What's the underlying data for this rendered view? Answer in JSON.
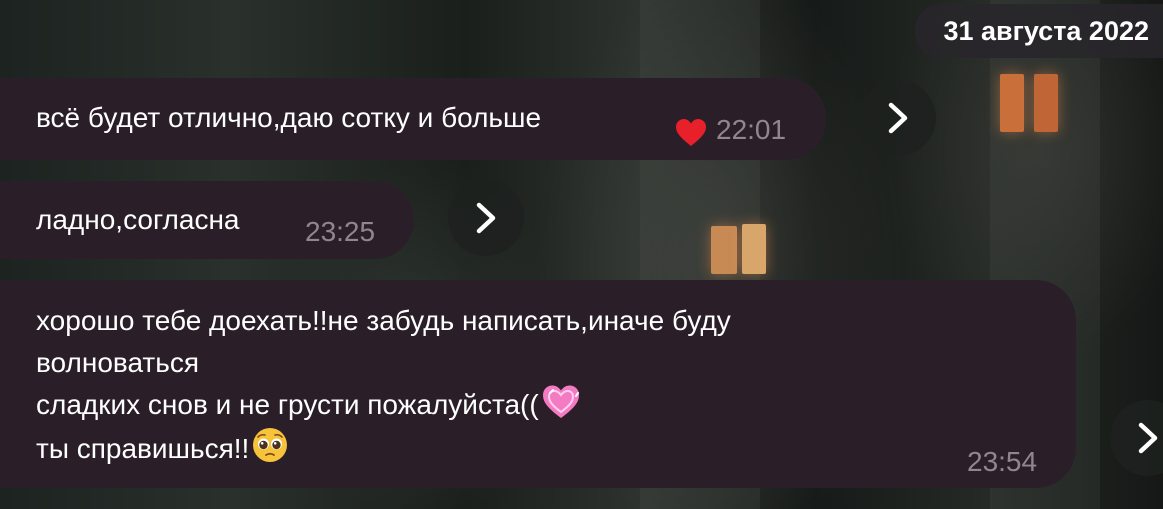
{
  "date_header": "31 августа 2022",
  "messages": [
    {
      "lines": [
        "всё будет отлично,даю сотку и больше"
      ],
      "time": "22:01",
      "reaction_icon": "red-heart"
    },
    {
      "lines": [
        "ладно,согласна"
      ],
      "time": "23:25"
    },
    {
      "lines": [
        "хорошо тебе доехать!!не забудь написать,иначе буду",
        "волноваться",
        "сладких снов и не грусти пожалуйста((",
        "ты справишься!!"
      ],
      "time": "23:54",
      "inline_icons": [
        "pink-heart-emoji",
        "pleading-face-emoji"
      ]
    }
  ],
  "forward_icon": "chevron-right-icon",
  "colors": {
    "bubble": "#2a1f29",
    "text": "#ffffff",
    "time": "#8f8790",
    "heart": "#e8202a",
    "pink_heart": "#f57ac4"
  }
}
